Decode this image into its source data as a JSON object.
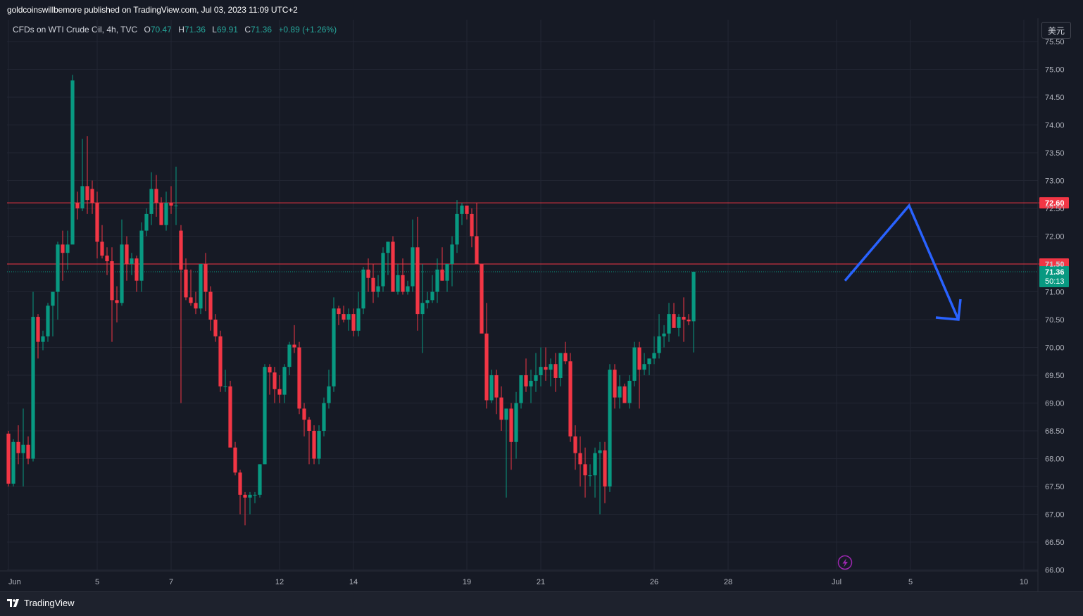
{
  "header": {
    "publish_line": "goldcoinswillbemore published on TradingView.com, Jul 03, 2023 11:09 UTC+2"
  },
  "legend": {
    "symbol": "CFDs on WTI Crude Oil, 4h, TVC",
    "open_label": "O",
    "open": "70.47",
    "high_label": "H",
    "high": "71.36",
    "low_label": "L",
    "low": "69.91",
    "close_label": "C",
    "close": "71.36",
    "change": "+0.89 (+1.26%)"
  },
  "currency_button": "美元",
  "footer": {
    "brand": "TradingView"
  },
  "colors": {
    "up": "#089981",
    "down": "#f23645",
    "projection": "#2962ff",
    "level": "#f23645",
    "background": "#161a25"
  },
  "chart_data": {
    "type": "candlestick",
    "title": "CFDs on WTI Crude Oil, 4h, TVC",
    "ylim": [
      66.0,
      75.75
    ],
    "y_ticks": [
      "75.50",
      "75.00",
      "74.50",
      "74.00",
      "73.50",
      "73.00",
      "72.50",
      "72.00",
      "71.50",
      "71.00",
      "70.50",
      "70.00",
      "69.50",
      "69.00",
      "68.50",
      "68.00",
      "67.50",
      "67.00",
      "66.50",
      "66.00"
    ],
    "x_ticks": [
      {
        "label": "Jun",
        "bar": 0
      },
      {
        "label": "5",
        "bar": 18
      },
      {
        "label": "7",
        "bar": 33
      },
      {
        "label": "12",
        "bar": 55
      },
      {
        "label": "14",
        "bar": 70
      },
      {
        "label": "19",
        "bar": 93
      },
      {
        "label": "21",
        "bar": 108
      },
      {
        "label": "26",
        "bar": 131
      },
      {
        "label": "28",
        "bar": 146
      },
      {
        "label": "Jul",
        "bar": 168
      },
      {
        "label": "5",
        "bar": 183
      },
      {
        "label": "10",
        "bar": 206
      }
    ],
    "candles": [
      {
        "o": 68.45,
        "h": 68.5,
        "l": 67.5,
        "c": 67.55
      },
      {
        "o": 67.55,
        "h": 68.35,
        "l": 67.5,
        "c": 68.3
      },
      {
        "o": 68.3,
        "h": 68.6,
        "l": 67.9,
        "c": 68.1
      },
      {
        "o": 68.1,
        "h": 68.9,
        "l": 67.5,
        "c": 68.25
      },
      {
        "o": 68.25,
        "h": 68.4,
        "l": 67.9,
        "c": 68.0
      },
      {
        "o": 68.0,
        "h": 71.0,
        "l": 67.95,
        "c": 70.55
      },
      {
        "o": 70.55,
        "h": 70.6,
        "l": 69.8,
        "c": 70.1
      },
      {
        "o": 70.1,
        "h": 70.3,
        "l": 69.95,
        "c": 70.2
      },
      {
        "o": 70.2,
        "h": 70.8,
        "l": 70.1,
        "c": 70.75
      },
      {
        "o": 70.75,
        "h": 71.0,
        "l": 70.2,
        "c": 71.0
      },
      {
        "o": 71.0,
        "h": 71.9,
        "l": 70.5,
        "c": 71.85
      },
      {
        "o": 71.85,
        "h": 72.1,
        "l": 71.2,
        "c": 71.7
      },
      {
        "o": 71.7,
        "h": 72.1,
        "l": 71.4,
        "c": 71.85
      },
      {
        "o": 71.85,
        "h": 74.9,
        "l": 72.2,
        "c": 74.8
      },
      {
        "o": 72.6,
        "h": 72.8,
        "l": 72.3,
        "c": 72.5
      },
      {
        "o": 72.5,
        "h": 73.75,
        "l": 72.45,
        "c": 72.9
      },
      {
        "o": 72.9,
        "h": 73.8,
        "l": 72.4,
        "c": 72.65
      },
      {
        "o": 72.85,
        "h": 73.0,
        "l": 72.4,
        "c": 72.6
      },
      {
        "o": 72.6,
        "h": 72.8,
        "l": 71.6,
        "c": 71.9
      },
      {
        "o": 71.9,
        "h": 72.2,
        "l": 71.6,
        "c": 71.65
      },
      {
        "o": 71.65,
        "h": 71.8,
        "l": 71.3,
        "c": 71.55
      },
      {
        "o": 71.55,
        "h": 71.8,
        "l": 70.1,
        "c": 70.85
      },
      {
        "o": 70.85,
        "h": 71.1,
        "l": 70.45,
        "c": 70.8
      },
      {
        "o": 70.8,
        "h": 72.3,
        "l": 70.75,
        "c": 71.85
      },
      {
        "o": 71.85,
        "h": 72.0,
        "l": 71.2,
        "c": 71.5
      },
      {
        "o": 71.5,
        "h": 71.7,
        "l": 71.3,
        "c": 71.6
      },
      {
        "o": 71.6,
        "h": 71.65,
        "l": 71.0,
        "c": 71.2
      },
      {
        "o": 71.2,
        "h": 72.25,
        "l": 71.0,
        "c": 72.1
      },
      {
        "o": 72.1,
        "h": 72.5,
        "l": 72.0,
        "c": 72.4
      },
      {
        "o": 72.4,
        "h": 73.15,
        "l": 72.2,
        "c": 72.85
      },
      {
        "o": 72.85,
        "h": 73.1,
        "l": 72.35,
        "c": 72.6
      },
      {
        "o": 72.6,
        "h": 72.7,
        "l": 72.2,
        "c": 72.2
      },
      {
        "o": 72.2,
        "h": 72.8,
        "l": 72.1,
        "c": 72.6
      },
      {
        "o": 72.6,
        "h": 72.9,
        "l": 72.4,
        "c": 72.55
      },
      {
        "o": 72.55,
        "h": 73.25,
        "l": 72.2,
        "c": 72.55
      },
      {
        "o": 72.1,
        "h": 72.2,
        "l": 69.0,
        "c": 71.4
      },
      {
        "o": 71.4,
        "h": 71.6,
        "l": 70.85,
        "c": 70.9
      },
      {
        "o": 70.9,
        "h": 71.4,
        "l": 70.75,
        "c": 70.8
      },
      {
        "o": 70.8,
        "h": 71.0,
        "l": 70.6,
        "c": 70.7
      },
      {
        "o": 70.7,
        "h": 71.4,
        "l": 70.6,
        "c": 71.5
      },
      {
        "o": 71.5,
        "h": 71.7,
        "l": 70.65,
        "c": 71.0
      },
      {
        "o": 71.0,
        "h": 71.1,
        "l": 70.3,
        "c": 70.5
      },
      {
        "o": 70.5,
        "h": 70.6,
        "l": 70.1,
        "c": 70.2
      },
      {
        "o": 70.2,
        "h": 70.3,
        "l": 69.2,
        "c": 69.3
      },
      {
        "o": 69.3,
        "h": 69.6,
        "l": 69.2,
        "c": 69.3
      },
      {
        "o": 69.3,
        "h": 69.4,
        "l": 68.3,
        "c": 68.2
      },
      {
        "o": 68.2,
        "h": 68.3,
        "l": 67.7,
        "c": 67.75
      },
      {
        "o": 67.75,
        "h": 67.8,
        "l": 67.0,
        "c": 67.35
      },
      {
        "o": 67.35,
        "h": 67.4,
        "l": 66.8,
        "c": 67.3
      },
      {
        "o": 67.3,
        "h": 67.4,
        "l": 67.0,
        "c": 67.35
      },
      {
        "o": 67.35,
        "h": 67.4,
        "l": 67.2,
        "c": 67.35
      },
      {
        "o": 67.35,
        "h": 67.9,
        "l": 67.3,
        "c": 67.9
      },
      {
        "o": 67.9,
        "h": 69.7,
        "l": 67.9,
        "c": 69.65
      },
      {
        "o": 69.65,
        "h": 69.7,
        "l": 69.15,
        "c": 69.55
      },
      {
        "o": 69.55,
        "h": 69.65,
        "l": 69.0,
        "c": 69.25
      },
      {
        "o": 69.25,
        "h": 69.5,
        "l": 69.0,
        "c": 69.15
      },
      {
        "o": 69.15,
        "h": 69.7,
        "l": 69.0,
        "c": 69.65
      },
      {
        "o": 69.65,
        "h": 70.1,
        "l": 69.5,
        "c": 70.05
      },
      {
        "o": 70.05,
        "h": 70.4,
        "l": 69.9,
        "c": 70.0
      },
      {
        "o": 70.0,
        "h": 70.1,
        "l": 68.8,
        "c": 68.9
      },
      {
        "o": 68.9,
        "h": 69.0,
        "l": 68.4,
        "c": 68.7
      },
      {
        "o": 68.7,
        "h": 68.75,
        "l": 67.9,
        "c": 68.5
      },
      {
        "o": 68.5,
        "h": 68.6,
        "l": 67.9,
        "c": 68.0
      },
      {
        "o": 68.0,
        "h": 68.6,
        "l": 67.9,
        "c": 68.5
      },
      {
        "o": 68.5,
        "h": 69.1,
        "l": 68.4,
        "c": 69.0
      },
      {
        "o": 69.0,
        "h": 69.6,
        "l": 68.9,
        "c": 69.3
      },
      {
        "o": 69.3,
        "h": 70.9,
        "l": 69.2,
        "c": 70.7
      },
      {
        "o": 70.7,
        "h": 70.75,
        "l": 70.4,
        "c": 70.6
      },
      {
        "o": 70.6,
        "h": 70.75,
        "l": 70.45,
        "c": 70.5
      },
      {
        "o": 70.5,
        "h": 70.7,
        "l": 70.3,
        "c": 70.6
      },
      {
        "o": 70.6,
        "h": 70.7,
        "l": 70.2,
        "c": 70.3
      },
      {
        "o": 70.3,
        "h": 71.0,
        "l": 70.2,
        "c": 70.7
      },
      {
        "o": 70.7,
        "h": 71.45,
        "l": 70.6,
        "c": 71.4
      },
      {
        "o": 71.4,
        "h": 71.6,
        "l": 71.0,
        "c": 71.25
      },
      {
        "o": 71.25,
        "h": 71.5,
        "l": 70.8,
        "c": 71.0
      },
      {
        "o": 71.0,
        "h": 71.3,
        "l": 70.9,
        "c": 71.1
      },
      {
        "o": 71.1,
        "h": 71.8,
        "l": 71.0,
        "c": 71.7
      },
      {
        "o": 71.7,
        "h": 71.9,
        "l": 71.3,
        "c": 71.9
      },
      {
        "o": 71.9,
        "h": 72.0,
        "l": 71.2,
        "c": 71.0
      },
      {
        "o": 71.0,
        "h": 71.5,
        "l": 70.95,
        "c": 71.3
      },
      {
        "o": 71.3,
        "h": 71.6,
        "l": 70.95,
        "c": 71.0
      },
      {
        "o": 71.0,
        "h": 71.2,
        "l": 70.95,
        "c": 71.1
      },
      {
        "o": 71.1,
        "h": 72.3,
        "l": 71.0,
        "c": 71.8
      },
      {
        "o": 71.8,
        "h": 72.35,
        "l": 70.3,
        "c": 70.6
      },
      {
        "o": 70.6,
        "h": 71.5,
        "l": 69.9,
        "c": 70.8
      },
      {
        "o": 70.8,
        "h": 71.0,
        "l": 70.7,
        "c": 70.85
      },
      {
        "o": 70.85,
        "h": 71.3,
        "l": 70.8,
        "c": 71.0
      },
      {
        "o": 71.0,
        "h": 71.6,
        "l": 70.8,
        "c": 71.4
      },
      {
        "o": 71.4,
        "h": 71.8,
        "l": 71.2,
        "c": 71.2
      },
      {
        "o": 71.2,
        "h": 71.4,
        "l": 71.0,
        "c": 71.5
      },
      {
        "o": 71.5,
        "h": 72.0,
        "l": 71.1,
        "c": 71.85
      },
      {
        "o": 71.85,
        "h": 72.65,
        "l": 71.7,
        "c": 72.4
      },
      {
        "o": 72.4,
        "h": 72.6,
        "l": 72.2,
        "c": 72.55
      },
      {
        "o": 72.55,
        "h": 72.55,
        "l": 72.3,
        "c": 72.4
      },
      {
        "o": 72.4,
        "h": 72.5,
        "l": 71.8,
        "c": 72.0
      },
      {
        "o": 72.0,
        "h": 72.6,
        "l": 71.5,
        "c": 71.5
      },
      {
        "o": 71.5,
        "h": 71.5,
        "l": 70.5,
        "c": 70.25
      },
      {
        "o": 70.25,
        "h": 70.8,
        "l": 68.9,
        "c": 69.05
      },
      {
        "o": 69.05,
        "h": 69.6,
        "l": 69.0,
        "c": 69.5
      },
      {
        "o": 69.5,
        "h": 69.6,
        "l": 68.8,
        "c": 69.1
      },
      {
        "o": 69.1,
        "h": 69.3,
        "l": 68.5,
        "c": 68.7
      },
      {
        "o": 68.7,
        "h": 68.9,
        "l": 67.3,
        "c": 68.9
      },
      {
        "o": 68.9,
        "h": 69.0,
        "l": 67.8,
        "c": 68.3
      },
      {
        "o": 68.3,
        "h": 69.2,
        "l": 68.0,
        "c": 69.0
      },
      {
        "o": 69.0,
        "h": 69.5,
        "l": 68.9,
        "c": 69.5
      },
      {
        "o": 69.5,
        "h": 69.8,
        "l": 69.2,
        "c": 69.3
      },
      {
        "o": 69.3,
        "h": 69.6,
        "l": 69.0,
        "c": 69.4
      },
      {
        "o": 69.4,
        "h": 69.9,
        "l": 69.2,
        "c": 69.5
      },
      {
        "o": 69.5,
        "h": 70.0,
        "l": 69.3,
        "c": 69.65
      },
      {
        "o": 69.65,
        "h": 70.0,
        "l": 69.4,
        "c": 69.6
      },
      {
        "o": 69.6,
        "h": 69.8,
        "l": 69.3,
        "c": 69.7
      },
      {
        "o": 69.7,
        "h": 69.9,
        "l": 69.2,
        "c": 69.45
      },
      {
        "o": 69.45,
        "h": 69.8,
        "l": 69.3,
        "c": 69.9
      },
      {
        "o": 69.9,
        "h": 70.1,
        "l": 69.7,
        "c": 69.75
      },
      {
        "o": 69.75,
        "h": 69.9,
        "l": 68.3,
        "c": 68.4
      },
      {
        "o": 68.4,
        "h": 68.6,
        "l": 67.8,
        "c": 68.1
      },
      {
        "o": 68.1,
        "h": 68.4,
        "l": 67.5,
        "c": 67.9
      },
      {
        "o": 67.9,
        "h": 68.2,
        "l": 67.3,
        "c": 67.7
      },
      {
        "o": 67.7,
        "h": 67.9,
        "l": 67.5,
        "c": 67.7
      },
      {
        "o": 67.7,
        "h": 68.2,
        "l": 67.3,
        "c": 68.1
      },
      {
        "o": 68.1,
        "h": 68.3,
        "l": 67.0,
        "c": 68.15
      },
      {
        "o": 68.15,
        "h": 68.3,
        "l": 67.2,
        "c": 67.5
      },
      {
        "o": 67.5,
        "h": 69.7,
        "l": 67.4,
        "c": 69.6
      },
      {
        "o": 69.6,
        "h": 69.7,
        "l": 68.9,
        "c": 69.1
      },
      {
        "o": 69.1,
        "h": 69.5,
        "l": 68.9,
        "c": 69.3
      },
      {
        "o": 69.3,
        "h": 69.35,
        "l": 69.0,
        "c": 69.0
      },
      {
        "o": 69.0,
        "h": 69.5,
        "l": 68.9,
        "c": 69.4
      },
      {
        "o": 69.4,
        "h": 70.1,
        "l": 69.3,
        "c": 70.0
      },
      {
        "o": 70.0,
        "h": 70.1,
        "l": 68.9,
        "c": 69.6
      },
      {
        "o": 69.6,
        "h": 69.9,
        "l": 69.5,
        "c": 69.7
      },
      {
        "o": 69.7,
        "h": 69.8,
        "l": 69.5,
        "c": 69.8
      },
      {
        "o": 69.8,
        "h": 70.2,
        "l": 69.7,
        "c": 69.9
      },
      {
        "o": 69.9,
        "h": 70.6,
        "l": 69.8,
        "c": 70.2
      },
      {
        "o": 70.2,
        "h": 70.4,
        "l": 70.0,
        "c": 70.25
      },
      {
        "o": 70.25,
        "h": 70.8,
        "l": 70.1,
        "c": 70.6
      },
      {
        "o": 70.6,
        "h": 70.8,
        "l": 70.4,
        "c": 70.35
      },
      {
        "o": 70.35,
        "h": 70.6,
        "l": 70.2,
        "c": 70.55
      },
      {
        "o": 70.55,
        "h": 70.9,
        "l": 70.1,
        "c": 70.5
      },
      {
        "o": 70.5,
        "h": 70.6,
        "l": 70.4,
        "c": 70.47
      },
      {
        "o": 70.47,
        "h": 71.36,
        "l": 69.91,
        "c": 71.36
      }
    ],
    "horizontal_levels": [
      {
        "value": 72.6,
        "label": "72.60"
      },
      {
        "value": 71.5,
        "label": "71.50"
      }
    ],
    "last_price": {
      "value": 71.36,
      "label": "71.36",
      "countdown": "50:13"
    },
    "projection": {
      "description": "up-then-down path",
      "points": [
        {
          "bar": 169,
          "price": 71.2
        },
        {
          "bar": 182,
          "price": 72.55
        },
        {
          "bar": 192,
          "price": 70.5
        }
      ]
    },
    "grid": true
  }
}
